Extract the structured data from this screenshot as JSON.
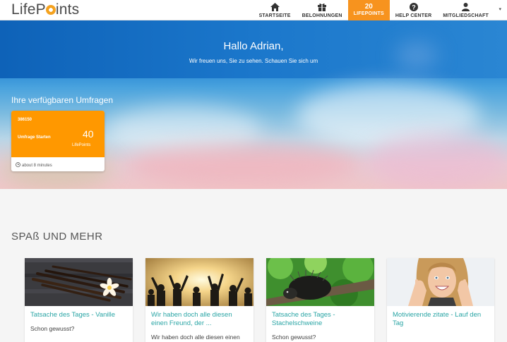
{
  "nav": {
    "logo": "LifePoints",
    "items": [
      {
        "label": "STARTSEITE",
        "icon": "home-icon"
      },
      {
        "label": "BELOHNUNGEN",
        "icon": "gift-icon"
      },
      {
        "label": "LIFEPOINTS",
        "value": "20"
      },
      {
        "label": "HELP CENTER",
        "icon": "help-icon"
      },
      {
        "label": "MITGLIEDSCHAFT",
        "icon": "user-icon"
      }
    ],
    "caret": "▾"
  },
  "hero": {
    "greeting": "Hallo Adrian,",
    "subtitle": "Wir freuen uns, Sie zu sehen. Schauen Sie sich um",
    "available_title": "Ihre verfügbaren Umfragen"
  },
  "survey": {
    "id": "386150",
    "start": "Umfrage Starten",
    "points": "40",
    "points_label": "LifePoints",
    "time": "about 8 minutes"
  },
  "fun": {
    "title": "SPAß UND MEHR",
    "cards": [
      {
        "title": "Tatsache des Tages - Vanille",
        "text": "Schon gewusst?"
      },
      {
        "title": "Wir haben doch alle diesen einen Freund, der ...",
        "text": "Wir haben doch alle diesen einen Freund, der föhrer de ist"
      },
      {
        "title": "Tatsache des Tages - Stachelschweine",
        "text": "Schon gewusst?"
      },
      {
        "title": "Motivierende zitate - Lauf den Tag",
        "text": ""
      }
    ]
  },
  "colors": {
    "accent": "#f7931e",
    "teal": "#2aa5a5",
    "hero_blue": "#1b77cb"
  }
}
